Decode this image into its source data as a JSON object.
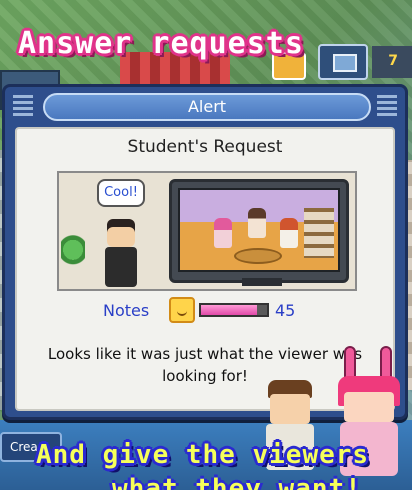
{
  "captions": {
    "top": "Answer requests",
    "bottom_line1": "And give the viewers",
    "bottom_line2": "what they want!"
  },
  "hud": {
    "count": "7",
    "create_label": "Crea"
  },
  "alert": {
    "title": "Alert",
    "request_title": "Student's Request",
    "speech": "Cool!",
    "notes_label": "Notes",
    "notes_value": "45",
    "notes_fill_fraction": 0.85,
    "message": "Looks like it was just what the viewer was looking for!"
  },
  "colors": {
    "caption_top_outline": "#e0338a",
    "caption_bottom_outline": "#2b2ad0",
    "dialog_frame": "#2e4e8c",
    "notes_text": "#2a3fc7",
    "notes_bar": "#e04aa8"
  },
  "icons": {
    "notes": "smiley-note-icon",
    "monitor": "monitor-icon",
    "grip": "grip-lines-icon"
  }
}
